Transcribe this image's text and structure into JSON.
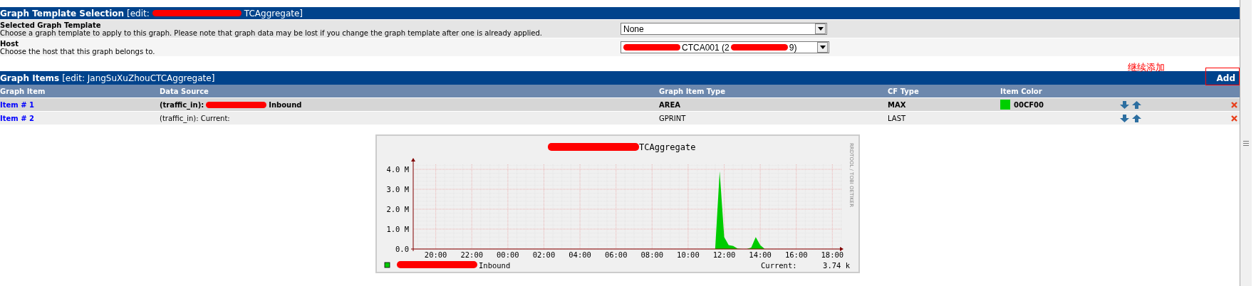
{
  "template_section": {
    "title": "Graph Template Selection",
    "edit": [
      {
        "kind": "text",
        "text": "[edit: "
      },
      {
        "kind": "redacted"
      },
      {
        "kind": "text",
        "text": "TCAggregate]"
      }
    ],
    "fields": [
      {
        "label": "Selected Graph Template",
        "description": "Choose a graph template to apply to this graph. Please note that graph data may be lost if you change the graph template after one is already applied.",
        "value": [
          {
            "kind": "text",
            "text": "None"
          }
        ]
      },
      {
        "label": "Host",
        "description": "Choose the host that this graph belongs to.",
        "value": [
          {
            "kind": "redacted"
          },
          {
            "kind": "text",
            "text": "CTCA001 (2"
          },
          {
            "kind": "redacted"
          },
          {
            "kind": "text",
            "text": "9)"
          }
        ]
      }
    ]
  },
  "items_section": {
    "title": "Graph Items",
    "edit": [
      {
        "kind": "text",
        "text": "[edit: JangSuXuZhouCTCAggregate]"
      }
    ],
    "annotation": "继续添加",
    "add_button": "Add",
    "columns": [
      "Graph Item",
      "Data Source",
      "Graph Item Type",
      "CF Type",
      "Item Color"
    ],
    "rows": [
      {
        "item": "Item # 1",
        "source": [
          {
            "kind": "text",
            "text": "(traffic_in): "
          },
          {
            "kind": "redacted"
          },
          {
            "kind": "text",
            "text": " Inbound"
          }
        ],
        "type": "AREA",
        "cf": "MAX",
        "color": "#00cf00",
        "color_text": "00CF00",
        "highlighted": true
      },
      {
        "item": "Item # 2",
        "source": [
          {
            "kind": "text",
            "text": "(traffic_in): Current:"
          }
        ],
        "type": "GPRINT",
        "cf": "LAST",
        "highlighted": false
      }
    ]
  },
  "graph": {
    "title": [
      {
        "kind": "redacted"
      },
      {
        "kind": "text",
        "text": "TCAggregate"
      }
    ],
    "side_label": "RRDTOOL / TOBI OETIKER",
    "legend_redacted": true,
    "current_label": "Current:",
    "current_value": "3.74 k",
    "chart_data": {
      "type": "area",
      "categories": [
        null,
        null,
        null,
        null,
        null,
        "20:00",
        null,
        null,
        null,
        null,
        null,
        null,
        null,
        "22:00",
        null,
        null,
        null,
        null,
        null,
        null,
        null,
        "00:00",
        null,
        null,
        null,
        null,
        null,
        null,
        null,
        "02:00",
        null,
        null,
        null,
        null,
        null,
        null,
        null,
        "04:00",
        null,
        null,
        null,
        null,
        null,
        null,
        null,
        "06:00",
        null,
        null,
        null,
        null,
        null,
        null,
        null,
        "08:00",
        null,
        null,
        null,
        null,
        null,
        null,
        null,
        "10:00",
        null,
        null,
        null,
        null,
        null,
        null,
        null,
        "12:00",
        null,
        null,
        null,
        null,
        null,
        null,
        null,
        "14:00",
        null,
        null,
        null,
        null,
        null,
        null,
        null,
        "16:00",
        null,
        null,
        null,
        null,
        null,
        null,
        null,
        "18:00",
        null,
        null
      ],
      "series": [
        {
          "name": "Inbound",
          "color": "#00cc00",
          "values": [
            0,
            0,
            0,
            0,
            0,
            0,
            0,
            0,
            0,
            0,
            0,
            0,
            0,
            0,
            0,
            0,
            0,
            0,
            0,
            0,
            0,
            0,
            0,
            0,
            0,
            0,
            0,
            0,
            0,
            0,
            0,
            0,
            0,
            0,
            0,
            0,
            0,
            0,
            0,
            0,
            0,
            0,
            0,
            0,
            0,
            0,
            0,
            0,
            0,
            0,
            0,
            0,
            0,
            0,
            0,
            0,
            0,
            0,
            0,
            0,
            0,
            0,
            0,
            0,
            0,
            0,
            0,
            0,
            3.9,
            0.6,
            0.2,
            0.15,
            0.02,
            0,
            0,
            0.07,
            0.6,
            0.2,
            0,
            0,
            0,
            0,
            0,
            0,
            0,
            0,
            0,
            0,
            0,
            0,
            0,
            0,
            0,
            0,
            0,
            0
          ]
        }
      ],
      "ylim": [
        0,
        4.25
      ],
      "grid": true,
      "yticks": [
        {
          "value": 0,
          "label": "0.0"
        },
        {
          "value": 1,
          "label": "1.0 M"
        },
        {
          "value": 2,
          "label": "2.0 M"
        },
        {
          "value": 3,
          "label": "3.0 M"
        },
        {
          "value": 4,
          "label": "4.0 M"
        }
      ]
    }
  }
}
